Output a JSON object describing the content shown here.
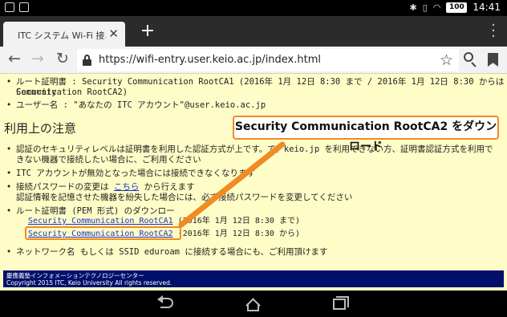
{
  "status_bar": {
    "time": "14:41",
    "battery": "100"
  },
  "tab": {
    "title": "ITC システム Wi-Fi 接..."
  },
  "toolbar": {
    "url": "https://wifi-entry.user.keio.ac.jp/index.html"
  },
  "page": {
    "items_top": [
      "ルート証明書 : Security Communication RootCA1 (2016年 1月 12日 8:30 まで / 2016年 1月 12日 8:30 からは Security",
      "Communication RootCA2)",
      "ユーザー名 : \"あなたの ITC アカウント\"@user.keio.ac.jp"
    ],
    "section_title": "利用上の注意",
    "notes": [
      "認証のセキュリティレベルは証明書を利用した認証方式が上です。で、keio.jp を利用できない方、証明書認証方式を利用で",
      "きない機器で接続したい場合に、ご利用ください",
      "ITC アカウントが無効となった場合には接続できなくなります",
      "接続パスワードの変更は",
      "こちら",
      "から行えます",
      "認証情報を記憶させた機器を紛失した場合には、必ず接続パスワードを変更してください",
      "ルート証明書 (PEM 形式) のダウンロー",
      "Security Communication RootCA1",
      " (2016年 1月 12日 8:30 まで)",
      "Security Communication RootCA2",
      " (2016年 1月 12日 8:30 から)",
      "ネットワーク名 もしくは SSID eduroam に接続する場合にも、ご利用頂けます"
    ],
    "callout": "Security Communication RootCA2 をダウンロード",
    "footer_line1": "慶應義塾インフォメーションテクノロジーセンター",
    "footer_line2": "Copyright 2015 ITC, Keio University All rights reserved."
  },
  "colors": {
    "page_bg": "#fffdc7",
    "footer_bg": "#00106b",
    "highlight": "#f08a24",
    "link": "#1a33cc"
  },
  "icons": [
    "notification-icon",
    "clipboard-icon",
    "bluetooth-icon",
    "vibrate-icon",
    "wifi-icon",
    "battery-icon",
    "close-icon",
    "plus-icon",
    "menu-dots-icon",
    "back-arrow-icon",
    "forward-arrow-icon",
    "reload-icon",
    "lock-icon",
    "star-icon",
    "search-icon",
    "bookmark-icon",
    "nav-back-icon",
    "nav-home-icon",
    "nav-recent-icon"
  ]
}
